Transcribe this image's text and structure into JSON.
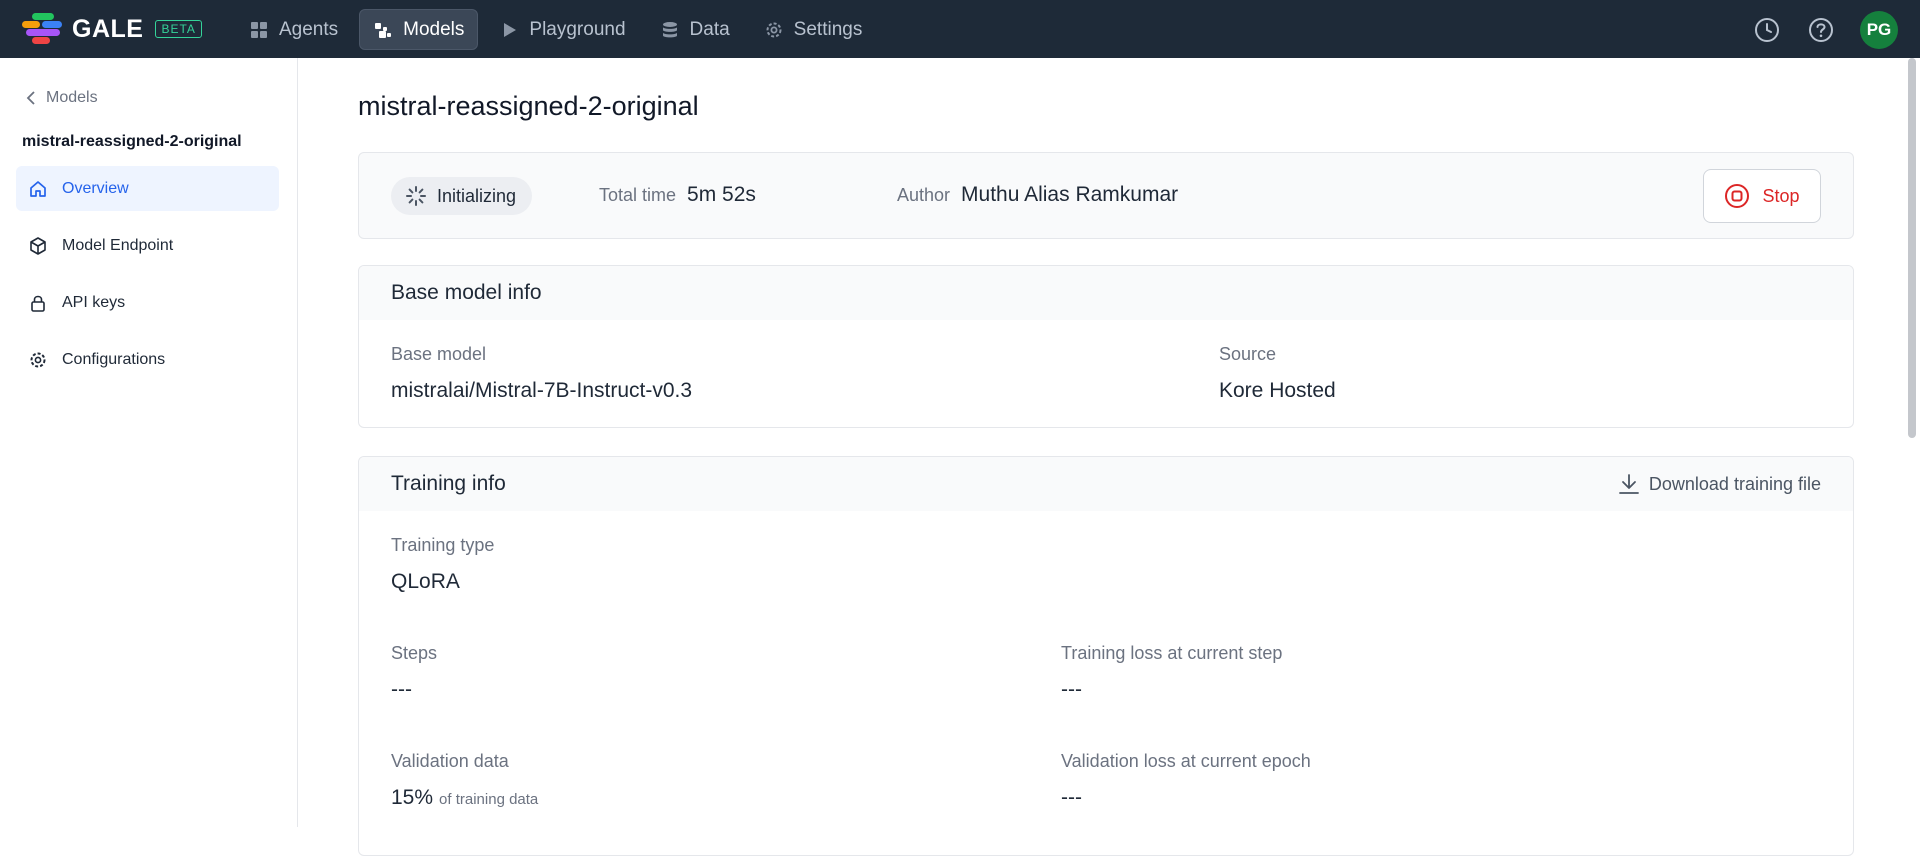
{
  "nav": {
    "brand": "GALE",
    "beta": "BETA",
    "items": [
      {
        "label": "Agents",
        "icon": "grid-icon"
      },
      {
        "label": "Models",
        "icon": "models-icon",
        "active": true
      },
      {
        "label": "Playground",
        "icon": "play-icon"
      },
      {
        "label": "Data",
        "icon": "database-icon"
      },
      {
        "label": "Settings",
        "icon": "gear-icon"
      }
    ],
    "avatar": "PG"
  },
  "sidebar": {
    "back_label": "Models",
    "title": "mistral-reassigned-2-original",
    "items": [
      {
        "label": "Overview",
        "icon": "home-icon",
        "active": true
      },
      {
        "label": "Model Endpoint",
        "icon": "cube-icon"
      },
      {
        "label": "API keys",
        "icon": "lock-icon"
      },
      {
        "label": "Configurations",
        "icon": "gear-icon"
      }
    ]
  },
  "main": {
    "title": "mistral-reassigned-2-original",
    "status": {
      "state": "Initializing",
      "total_time_label": "Total time",
      "total_time": "5m 52s",
      "author_label": "Author",
      "author": "Muthu Alias Ramkumar",
      "stop_label": "Stop"
    },
    "base_model_info": {
      "heading": "Base model info",
      "base_model_label": "Base model",
      "base_model": "mistralai/Mistral-7B-Instruct-v0.3",
      "source_label": "Source",
      "source": "Kore Hosted"
    },
    "training_info": {
      "heading": "Training info",
      "download_label": "Download training file",
      "training_type_label": "Training type",
      "training_type": "QLoRA",
      "steps_label": "Steps",
      "steps": "---",
      "training_loss_label": "Training loss at current step",
      "training_loss": "---",
      "validation_data_label": "Validation data",
      "validation_pct": "15%",
      "validation_suffix": "of training data",
      "validation_loss_label": "Validation loss at current epoch",
      "validation_loss": "---"
    }
  },
  "colors": {
    "topbar": "#1e2a38",
    "accent": "#2563eb",
    "stop": "#dc2626",
    "avatar": "#15803d",
    "beta": "#34d399"
  }
}
